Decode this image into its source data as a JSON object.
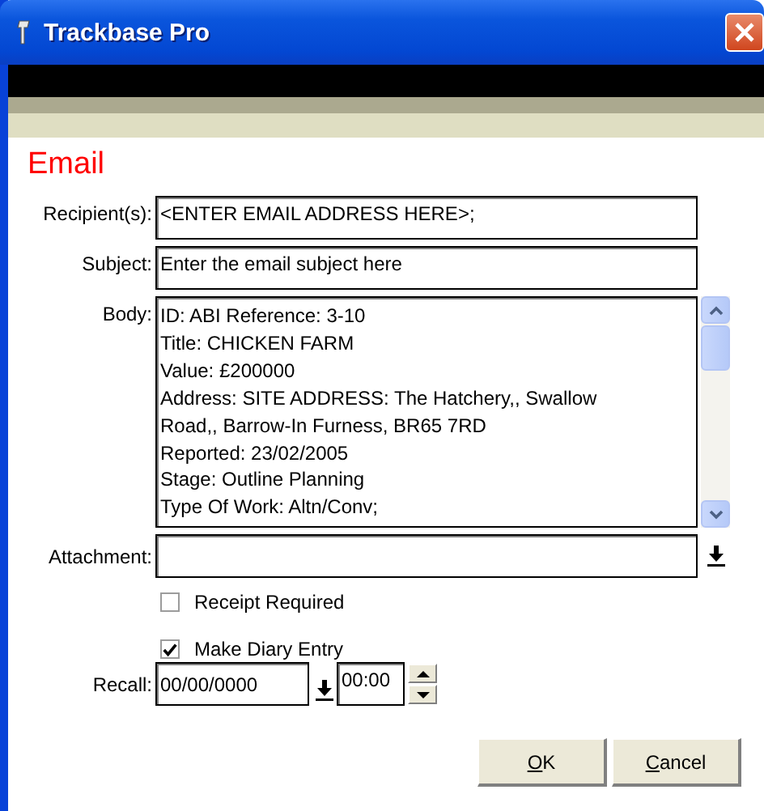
{
  "window": {
    "title": "Trackbase Pro"
  },
  "heading": "Email",
  "recipients": {
    "label": "Recipient(s):",
    "value": "<ENTER EMAIL ADDRESS HERE>;"
  },
  "subject": {
    "label": "Subject:",
    "value": "Enter the email subject here"
  },
  "body": {
    "label": "Body:",
    "lines": [
      "ID: ABI Reference: 3-10",
      "Title: CHICKEN FARM",
      "Value: £200000",
      "Address: SITE ADDRESS: The Hatchery,, Swallow",
      "Road,, Barrow-In Furness, BR65 7RD",
      "Reported: 23/02/2005",
      "Stage: Outline Planning",
      "Type Of Work: Altn/Conv;"
    ]
  },
  "attachment": {
    "label": "Attachment:"
  },
  "options": [
    {
      "label": "Receipt Required",
      "checked": false
    },
    {
      "label": "Make Diary Entry",
      "checked": true
    }
  ],
  "recall": {
    "label": "Recall:",
    "date": "00/00/0000",
    "time": "00:00"
  },
  "buttons": [
    "OK",
    "Cancel"
  ]
}
